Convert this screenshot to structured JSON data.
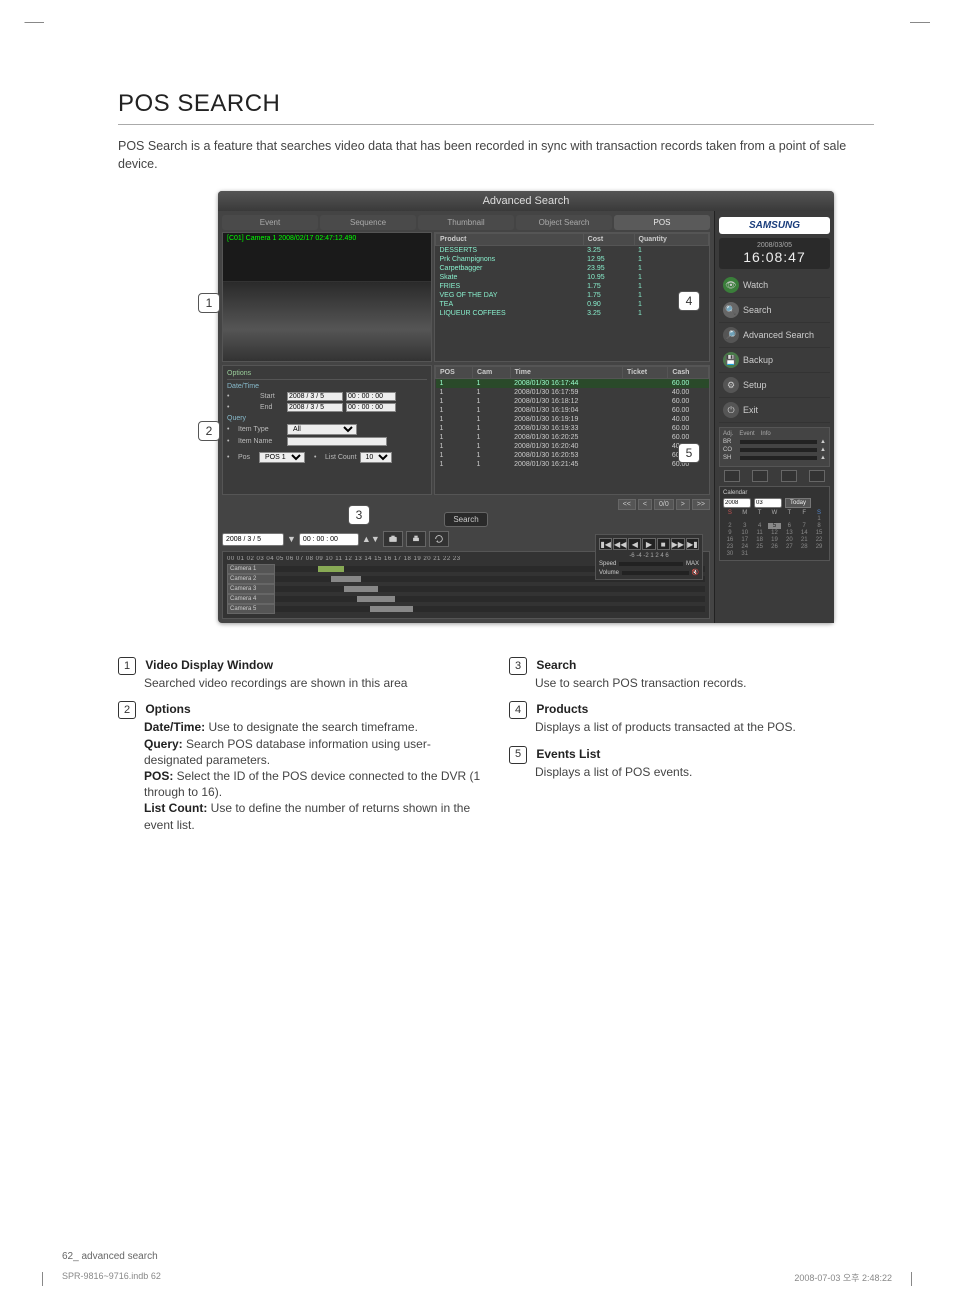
{
  "page": {
    "heading": "POS SEARCH",
    "intro": "POS Search is a feature that searches video data that has been recorded in sync with transaction records taken from a point of sale device.",
    "footer_left": "62_ advanced search",
    "footer_file": "SPR-9816~9716.indb   62",
    "footer_right": "2008-07-03   오후 2:48:22"
  },
  "app": {
    "title": "Advanced Search",
    "tabs": [
      "Event",
      "Sequence",
      "Thumbnail",
      "Object Search",
      "POS"
    ],
    "active_tab_index": 4,
    "video_stamp": "[C01] Camera 1 2008/02/17  02:47:12.490",
    "products": {
      "headers": [
        "Product",
        "Cost",
        "Quantity"
      ],
      "rows": [
        [
          "DESSERTS",
          "3.25",
          "1"
        ],
        [
          "Prk Champignons",
          "12.95",
          "1"
        ],
        [
          "Carpetbagger",
          "23.95",
          "1"
        ],
        [
          "Skate",
          "10.95",
          "1"
        ],
        [
          "FRIES",
          "1.75",
          "1"
        ],
        [
          "VEG OF THE DAY",
          "1.75",
          "1"
        ],
        [
          "TEA",
          "0.90",
          "1"
        ],
        [
          "LIQUEUR COFFEES",
          "3.25",
          "1"
        ]
      ]
    },
    "options": {
      "panel_label": "Options",
      "date_label": "Date/Time",
      "start_label": "Start",
      "end_label": "End",
      "start_date": "2008 / 3 / 5",
      "start_time": "00 : 00 : 00",
      "end_date": "2008 / 3 / 5",
      "end_time": "00 : 00 : 00",
      "query_label": "Query",
      "item_type_label": "Item Type",
      "item_type_value": "All",
      "item_name_label": "Item Name",
      "item_name_value": "",
      "pos_label": "Pos",
      "pos_value": "POS 1",
      "list_count_label": "List Count",
      "list_count_value": "10"
    },
    "search_button": "Search",
    "pager": {
      "prev": "<<",
      "prevp": "<",
      "current": "0/0",
      "nextp": ">",
      "next": ">>"
    },
    "events": {
      "headers": [
        "POS",
        "Cam",
        "Time",
        "Ticket",
        "Cash"
      ],
      "rows": [
        [
          "1",
          "1",
          "2008/01/30 16:17:44",
          "",
          "60.00"
        ],
        [
          "1",
          "1",
          "2008/01/30 16:17:59",
          "",
          "40.00"
        ],
        [
          "1",
          "1",
          "2008/01/30 16:18:12",
          "",
          "60.00"
        ],
        [
          "1",
          "1",
          "2008/01/30 16:19:04",
          "",
          "60.00"
        ],
        [
          "1",
          "1",
          "2008/01/30 16:19:19",
          "",
          "40.00"
        ],
        [
          "1",
          "1",
          "2008/01/30 16:19:33",
          "",
          "60.00"
        ],
        [
          "1",
          "1",
          "2008/01/30 16:20:25",
          "",
          "60.00"
        ],
        [
          "1",
          "1",
          "2008/01/30 16:20:40",
          "",
          "40.00"
        ],
        [
          "1",
          "1",
          "2008/01/30 16:20:53",
          "",
          "60.00"
        ],
        [
          "1",
          "1",
          "2008/01/30 16:21:45",
          "",
          "60.00"
        ]
      ]
    },
    "dt_bar": {
      "date": "2008 / 3 / 5",
      "time": "00 : 00 : 00"
    },
    "cameras": [
      "Camera 1",
      "Camera 2",
      "Camera 3",
      "Camera 4",
      "Camera 5"
    ],
    "ruler": "00 01 02 03 04 05 06 07 08 09 10 11 12 13 14 15 16 17 18 19 20 21 22 23",
    "play": {
      "scale": "-6 -4 -2  1  2  4  6",
      "speed_label": "Speed",
      "max_label": "MAX",
      "volume_label": "Volume"
    },
    "right": {
      "brand": "SAMSUNG",
      "clock_date": "2008/03/05",
      "clock_time": "16:08:47",
      "menu": [
        "Watch",
        "Search",
        "Advanced Search",
        "Backup",
        "Setup",
        "Exit"
      ],
      "adj": {
        "tabs": [
          "Adj.",
          "Event",
          "Info"
        ],
        "sliders": [
          "BR",
          "CO",
          "SH"
        ]
      },
      "calendar": {
        "label": "Calendar",
        "year": "2008",
        "month": "03",
        "today_btn": "Today",
        "days": [
          "S",
          "M",
          "T",
          "W",
          "T",
          "F",
          "S"
        ],
        "sel_day": "5"
      }
    }
  },
  "desc": {
    "items": [
      {
        "n": "1",
        "title": "Video Display Window",
        "body": "Searched video recordings are shown in this area"
      },
      {
        "n": "2",
        "title": "Options",
        "subs": [
          {
            "k": "Date/Time:",
            "v": " Use to designate the search timeframe."
          },
          {
            "k": "Query:",
            "v": " Search POS database information using user-designated parameters."
          },
          {
            "k": "POS:",
            "v": " Select the ID of the POS device connected to the DVR (1 through to 16)."
          },
          {
            "k": "List Count:",
            "v": " Use to define the number of returns shown in the event list."
          }
        ]
      },
      {
        "n": "3",
        "title": "Search",
        "body": "Use to search POS transaction records."
      },
      {
        "n": "4",
        "title": "Products",
        "body": "Displays a list of products transacted at the POS."
      },
      {
        "n": "5",
        "title": "Events List",
        "body": "Displays a list of POS events."
      }
    ]
  }
}
